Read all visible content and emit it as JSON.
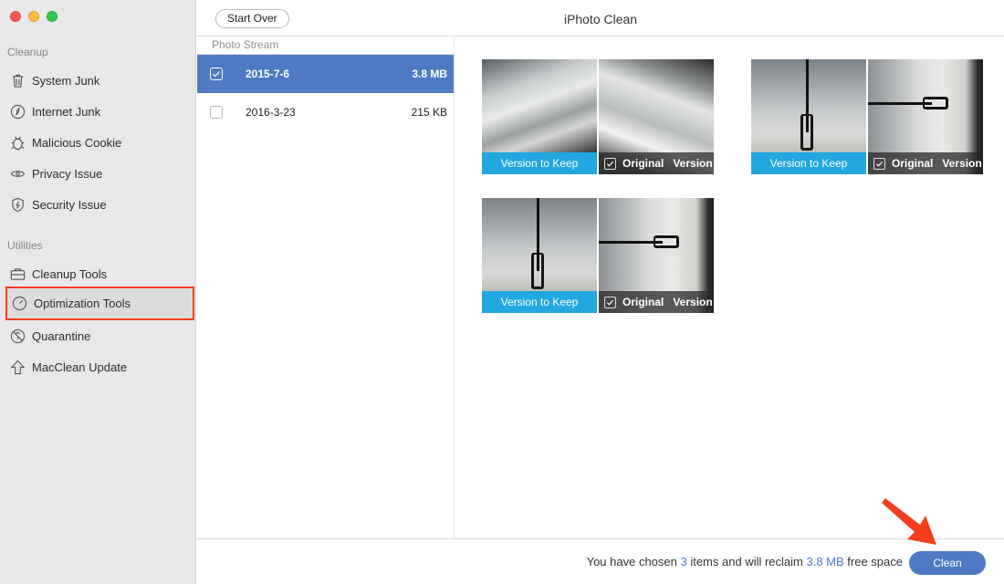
{
  "window": {
    "title": "iPhoto Clean",
    "traffic_lights": [
      "close",
      "minimize",
      "maximize"
    ]
  },
  "sidebar": {
    "sections": [
      {
        "label": "Cleanup",
        "items": [
          {
            "label": "System Junk",
            "icon": "trash-icon"
          },
          {
            "label": "Internet Junk",
            "icon": "compass-icon"
          },
          {
            "label": "Malicious Cookie",
            "icon": "bug-icon"
          },
          {
            "label": "Privacy Issue",
            "icon": "eye-icon"
          },
          {
            "label": "Security Issue",
            "icon": "shield-icon"
          }
        ]
      },
      {
        "label": "Utilities",
        "items": [
          {
            "label": "Cleanup Tools",
            "icon": "toolbox-icon"
          },
          {
            "label": "Optimization Tools",
            "icon": "gauge-icon",
            "active": true
          },
          {
            "label": "Quarantine",
            "icon": "quarantine-icon"
          },
          {
            "label": "MacClean Update",
            "icon": "arrow-up-icon"
          }
        ]
      }
    ]
  },
  "header": {
    "start_over_label": "Start Over"
  },
  "list": {
    "header": "Photo Stream",
    "rows": [
      {
        "date": "2015-7-6",
        "size": "3.8 MB",
        "checked": true,
        "selected": true
      },
      {
        "date": "2016-3-23",
        "size": "215 KB",
        "checked": false,
        "selected": false
      }
    ]
  },
  "gallery": {
    "keep_caption": "Version to Keep",
    "original_caption_a": "Original",
    "original_caption_b": "Version",
    "pairs": [
      {
        "keep_photo": "stairs",
        "original_photo": "stairs-rotated",
        "original_checked": true
      },
      {
        "keep_photo": "hall-tripod",
        "original_photo": "hall-tripod-rotated",
        "original_checked": true
      },
      {
        "keep_photo": "hall-tripod",
        "original_photo": "hall-tripod-rotated",
        "original_checked": true
      }
    ]
  },
  "footer": {
    "text_prefix": "You have chosen ",
    "item_count": "3",
    "text_middle": " items and will reclaim ",
    "reclaim_size": "3.8 MB",
    "text_suffix": " free space",
    "clean_label": "Clean",
    "accent_color": "#4e7ac4"
  },
  "annotation": {
    "arrow_color": "#f53d1f",
    "highlight_color": "#f53d1f"
  }
}
